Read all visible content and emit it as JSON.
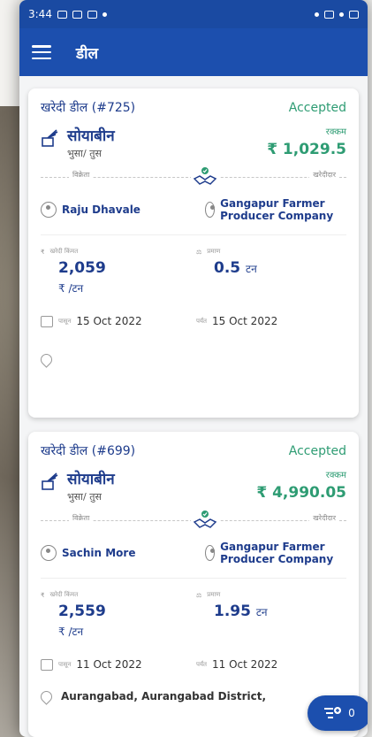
{
  "status_bar": {
    "time": "3:44"
  },
  "app_bar": {
    "title": "डील"
  },
  "deals": [
    {
      "id": "खरेदी डील (#725)",
      "status": "Accepted",
      "crop": "सोयाबीन",
      "variant": "भुसा/ तुस",
      "amount_label": "रक्कम",
      "amount": "₹ 1,029.5",
      "seller_label": "विक्रेता",
      "buyer_label": "खरेदीदार",
      "seller": "Raju Dhavale",
      "buyer": "Gangapur Farmer Producer Company",
      "price_label": "खरेदी किंमत",
      "price": "2,059",
      "price_unit": "₹ /टन",
      "qty_label": "प्रमाण",
      "qty": "0.5",
      "qty_unit": "टन",
      "from_label": "पासून",
      "from_date": "15 Oct 2022",
      "to_label": "पर्यंत",
      "to_date": "15 Oct 2022",
      "location": ""
    },
    {
      "id": "खरेदी डील (#699)",
      "status": "Accepted",
      "crop": "सोयाबीन",
      "variant": "भुसा/ तुस",
      "amount_label": "रक्कम",
      "amount": "₹ 4,990.05",
      "seller_label": "विक्रेता",
      "buyer_label": "खरेदीदार",
      "seller": "Sachin More",
      "buyer": "Gangapur Farmer Producer Company",
      "price_label": "खरेदी किंमत",
      "price": "2,559",
      "price_unit": "₹ /टन",
      "qty_label": "प्रमाण",
      "qty": "1.95",
      "qty_unit": "टन",
      "from_label": "पासून",
      "from_date": "11 Oct 2022",
      "to_label": "पर्यंत",
      "to_date": "11 Oct 2022",
      "location": "Aurangabad, Aurangabad District,"
    }
  ],
  "fab": {
    "count": "0",
    "icon": "filter-add-icon"
  },
  "colors": {
    "primary": "#1c4fae",
    "accent_green": "#2e9c73",
    "text_blue": "#1e3c8c"
  }
}
